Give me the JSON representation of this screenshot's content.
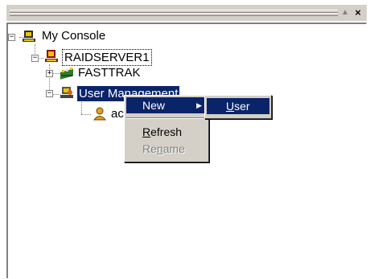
{
  "tree": {
    "root": {
      "label": "My Console",
      "expander": "−"
    },
    "server": {
      "label": "RAIDSERVER1",
      "expander": "−"
    },
    "fasttrak": {
      "label": "FASTTRAK",
      "expander": "+"
    },
    "user_mgmt": {
      "label": "User Management",
      "expander": "−"
    },
    "user_child": {
      "label": "ac"
    }
  },
  "context_menu": {
    "new": {
      "label": "New",
      "arrow": "▶"
    },
    "refresh": {
      "label_prefix": "",
      "label_ul": "R",
      "label_rest": "efresh"
    },
    "rename": {
      "label_prefix": "Re",
      "label_ul": "n",
      "label_rest": "ame",
      "disabled": true
    }
  },
  "submenu": {
    "user": {
      "label_ul": "U",
      "label_rest": "ser"
    }
  },
  "titlebar": {
    "up_glyph": "▲",
    "close_glyph": "×"
  },
  "colors": {
    "selection": "#0a246a",
    "menu_bg": "#d4d0c8"
  }
}
